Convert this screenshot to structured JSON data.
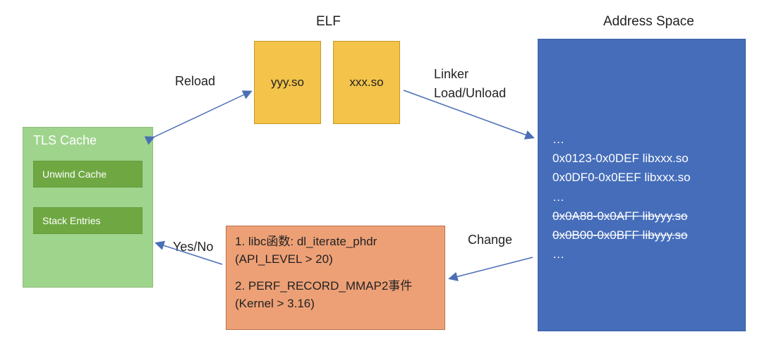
{
  "elf": {
    "title": "ELF",
    "so_left": "yyy.so",
    "so_right": "xxx.so"
  },
  "address_space": {
    "title": "Address Space",
    "lines": [
      {
        "text": "…",
        "strike": false
      },
      {
        "text": "0x0123-0x0DEF   libxxx.so",
        "strike": false
      },
      {
        "text": "0x0DF0-0x0EEF   libxxx.so",
        "strike": false
      },
      {
        "text": "…",
        "strike": false
      },
      {
        "text": "0x0A88-0x0AFF   libyyy.so",
        "strike": true
      },
      {
        "text": "0x0B00-0x0BFF   libyyy.so",
        "strike": true
      },
      {
        "text": "…",
        "strike": false
      }
    ]
  },
  "tls": {
    "title": "TLS Cache",
    "unwind": "Unwind Cache",
    "stack": "Stack Entries"
  },
  "methods": {
    "line1": "1. libc函数: dl_iterate_phdr",
    "line2": "(API_LEVEL > 20)",
    "line3": "2. PERF_RECORD_MMAP2事件",
    "line4": "(Kernel > 3.16)"
  },
  "labels": {
    "reload": "Reload",
    "linker": "Linker\nLoad/Unload",
    "yesno": "Yes/No",
    "change": "Change"
  }
}
